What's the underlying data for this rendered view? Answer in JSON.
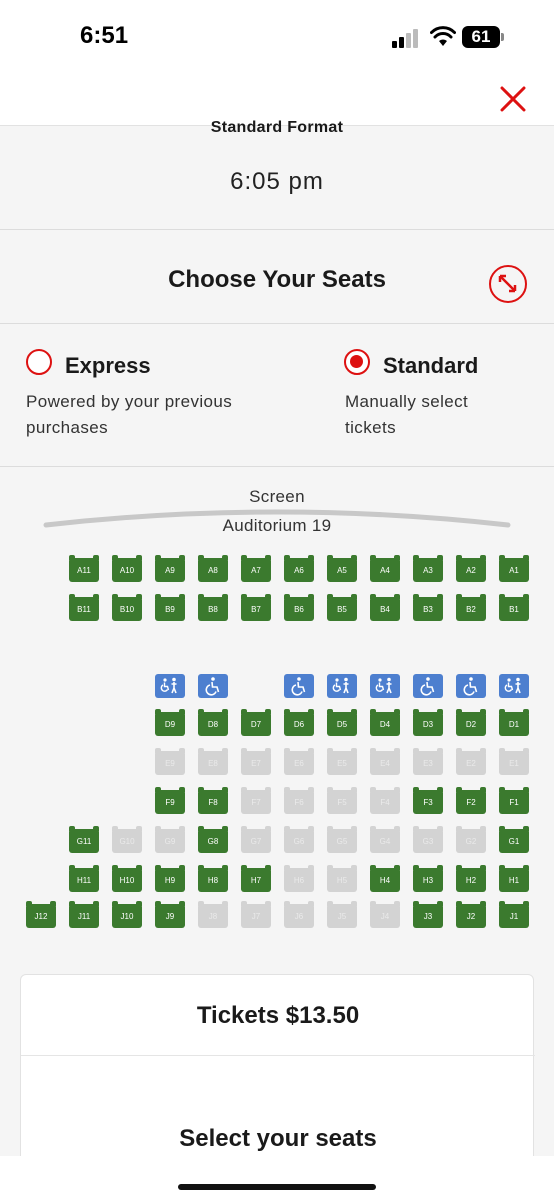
{
  "status": {
    "time": "6:51",
    "battery": "61"
  },
  "format_label": "Standard Format",
  "showtime": "6:05 pm",
  "title": "Choose Your Seats",
  "options": {
    "express": {
      "title": "Express",
      "desc_line1": "Powered by your previous",
      "desc_line2": "purchases",
      "selected": false
    },
    "standard": {
      "title": "Standard",
      "desc_line1": "Manually select",
      "desc_line2": "tickets",
      "selected": true
    }
  },
  "screen_label": "Screen",
  "auditorium": "Auditorium 19",
  "colors": {
    "accent": "#dd1111",
    "available": "#3b7a2e",
    "unavailable": "#d3d3d3",
    "accessible": "#4d7fcf"
  },
  "seat_rows": [
    {
      "row": "A",
      "seats": [
        {
          "label": "A11",
          "col": 1,
          "status": "available"
        },
        {
          "label": "A10",
          "col": 2,
          "status": "available"
        },
        {
          "label": "A9",
          "col": 3,
          "status": "available"
        },
        {
          "label": "A8",
          "col": 4,
          "status": "available"
        },
        {
          "label": "A7",
          "col": 5,
          "status": "available"
        },
        {
          "label": "A6",
          "col": 6,
          "status": "available"
        },
        {
          "label": "A5",
          "col": 7,
          "status": "available"
        },
        {
          "label": "A4",
          "col": 8,
          "status": "available"
        },
        {
          "label": "A3",
          "col": 9,
          "status": "available"
        },
        {
          "label": "A2",
          "col": 10,
          "status": "available"
        },
        {
          "label": "A1",
          "col": 11,
          "status": "available"
        }
      ]
    },
    {
      "row": "B",
      "seats": [
        {
          "label": "B11",
          "col": 1,
          "status": "available"
        },
        {
          "label": "B10",
          "col": 2,
          "status": "available"
        },
        {
          "label": "B9",
          "col": 3,
          "status": "available"
        },
        {
          "label": "B8",
          "col": 4,
          "status": "available"
        },
        {
          "label": "B7",
          "col": 5,
          "status": "available"
        },
        {
          "label": "B6",
          "col": 6,
          "status": "available"
        },
        {
          "label": "B5",
          "col": 7,
          "status": "available"
        },
        {
          "label": "B4",
          "col": 8,
          "status": "available"
        },
        {
          "label": "B3",
          "col": 9,
          "status": "available"
        },
        {
          "label": "B2",
          "col": 10,
          "status": "available"
        },
        {
          "label": "B1",
          "col": 11,
          "status": "available"
        }
      ]
    },
    {
      "row": "C",
      "seats": [
        {
          "label": "",
          "col": 3,
          "status": "accessible",
          "icon": "companion-icon"
        },
        {
          "label": "",
          "col": 4,
          "status": "accessible",
          "icon": "wheelchair-icon"
        },
        {
          "label": "",
          "col": 6,
          "status": "accessible",
          "icon": "wheelchair-icon"
        },
        {
          "label": "",
          "col": 7,
          "status": "accessible",
          "icon": "companion-icon"
        },
        {
          "label": "",
          "col": 8,
          "status": "accessible",
          "icon": "companion-icon"
        },
        {
          "label": "",
          "col": 9,
          "status": "accessible",
          "icon": "wheelchair-icon"
        },
        {
          "label": "",
          "col": 10,
          "status": "accessible",
          "icon": "wheelchair-icon"
        },
        {
          "label": "",
          "col": 11,
          "status": "accessible",
          "icon": "companion-icon"
        }
      ]
    },
    {
      "row": "D",
      "seats": [
        {
          "label": "D9",
          "col": 3,
          "status": "available"
        },
        {
          "label": "D8",
          "col": 4,
          "status": "available"
        },
        {
          "label": "D7",
          "col": 5,
          "status": "available"
        },
        {
          "label": "D6",
          "col": 6,
          "status": "available"
        },
        {
          "label": "D5",
          "col": 7,
          "status": "available"
        },
        {
          "label": "D4",
          "col": 8,
          "status": "available"
        },
        {
          "label": "D3",
          "col": 9,
          "status": "available"
        },
        {
          "label": "D2",
          "col": 10,
          "status": "available"
        },
        {
          "label": "D1",
          "col": 11,
          "status": "available"
        }
      ]
    },
    {
      "row": "E",
      "seats": [
        {
          "label": "E9",
          "col": 3,
          "status": "unavailable"
        },
        {
          "label": "E8",
          "col": 4,
          "status": "unavailable"
        },
        {
          "label": "E7",
          "col": 5,
          "status": "unavailable"
        },
        {
          "label": "E6",
          "col": 6,
          "status": "unavailable"
        },
        {
          "label": "E5",
          "col": 7,
          "status": "unavailable"
        },
        {
          "label": "E4",
          "col": 8,
          "status": "unavailable"
        },
        {
          "label": "E3",
          "col": 9,
          "status": "unavailable"
        },
        {
          "label": "E2",
          "col": 10,
          "status": "unavailable"
        },
        {
          "label": "E1",
          "col": 11,
          "status": "unavailable"
        }
      ]
    },
    {
      "row": "F",
      "seats": [
        {
          "label": "F9",
          "col": 3,
          "status": "available"
        },
        {
          "label": "F8",
          "col": 4,
          "status": "available"
        },
        {
          "label": "F7",
          "col": 5,
          "status": "unavailable"
        },
        {
          "label": "F6",
          "col": 6,
          "status": "unavailable"
        },
        {
          "label": "F5",
          "col": 7,
          "status": "unavailable"
        },
        {
          "label": "F4",
          "col": 8,
          "status": "unavailable"
        },
        {
          "label": "F3",
          "col": 9,
          "status": "available"
        },
        {
          "label": "F2",
          "col": 10,
          "status": "available"
        },
        {
          "label": "F1",
          "col": 11,
          "status": "available"
        }
      ]
    },
    {
      "row": "G",
      "seats": [
        {
          "label": "G11",
          "col": 1,
          "status": "available"
        },
        {
          "label": "G10",
          "col": 2,
          "status": "unavailable"
        },
        {
          "label": "G9",
          "col": 3,
          "status": "unavailable"
        },
        {
          "label": "G8",
          "col": 4,
          "status": "available"
        },
        {
          "label": "G7",
          "col": 5,
          "status": "unavailable"
        },
        {
          "label": "G6",
          "col": 6,
          "status": "unavailable"
        },
        {
          "label": "G5",
          "col": 7,
          "status": "unavailable"
        },
        {
          "label": "G4",
          "col": 8,
          "status": "unavailable"
        },
        {
          "label": "G3",
          "col": 9,
          "status": "unavailable"
        },
        {
          "label": "G2",
          "col": 10,
          "status": "unavailable"
        },
        {
          "label": "G1",
          "col": 11,
          "status": "available"
        }
      ]
    },
    {
      "row": "H",
      "seats": [
        {
          "label": "H11",
          "col": 1,
          "status": "available"
        },
        {
          "label": "H10",
          "col": 2,
          "status": "available"
        },
        {
          "label": "H9",
          "col": 3,
          "status": "available"
        },
        {
          "label": "H8",
          "col": 4,
          "status": "available"
        },
        {
          "label": "H7",
          "col": 5,
          "status": "available"
        },
        {
          "label": "H6",
          "col": 6,
          "status": "unavailable"
        },
        {
          "label": "H5",
          "col": 7,
          "status": "unavailable"
        },
        {
          "label": "H4",
          "col": 8,
          "status": "available"
        },
        {
          "label": "H3",
          "col": 9,
          "status": "available"
        },
        {
          "label": "H2",
          "col": 10,
          "status": "available"
        },
        {
          "label": "H1",
          "col": 11,
          "status": "available"
        }
      ]
    },
    {
      "row": "J",
      "seats": [
        {
          "label": "J12",
          "col": 0,
          "status": "available"
        },
        {
          "label": "J11",
          "col": 1,
          "status": "available"
        },
        {
          "label": "J10",
          "col": 2,
          "status": "available"
        },
        {
          "label": "J9",
          "col": 3,
          "status": "available"
        },
        {
          "label": "J8",
          "col": 4,
          "status": "unavailable"
        },
        {
          "label": "J7",
          "col": 5,
          "status": "unavailable"
        },
        {
          "label": "J6",
          "col": 6,
          "status": "unavailable"
        },
        {
          "label": "J5",
          "col": 7,
          "status": "unavailable"
        },
        {
          "label": "J4",
          "col": 8,
          "status": "unavailable"
        },
        {
          "label": "J3",
          "col": 9,
          "status": "available"
        },
        {
          "label": "J2",
          "col": 10,
          "status": "available"
        },
        {
          "label": "J1",
          "col": 11,
          "status": "available"
        }
      ]
    }
  ],
  "tickets_label": "Tickets $13.50",
  "select_seats_label": "Select your seats"
}
